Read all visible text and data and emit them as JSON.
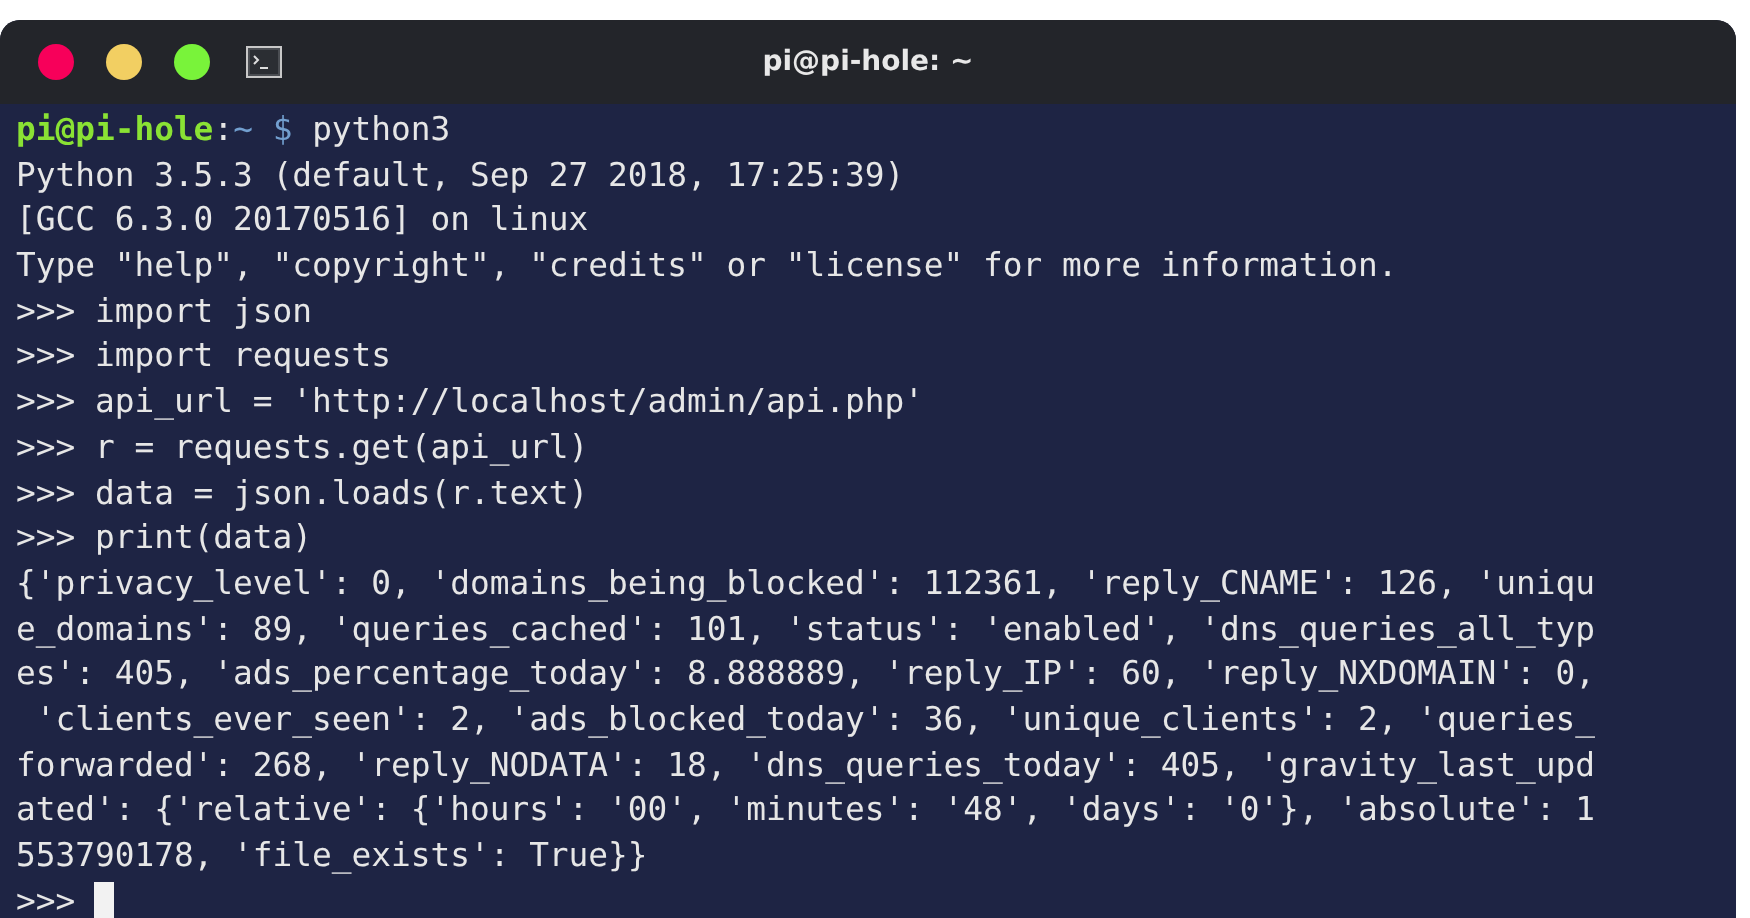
{
  "window": {
    "title": "pi@pi-hole: ~"
  },
  "terminal": {
    "lines": [
      {
        "kind": "prompt",
        "user_host": "pi@pi-hole",
        "separator": ":",
        "path": "~",
        "symbol": "$",
        "command": "python3"
      },
      {
        "kind": "output",
        "text": "Python 3.5.3 (default, Sep 27 2018, 17:25:39)"
      },
      {
        "kind": "output",
        "text": "[GCC 6.3.0 20170516] on linux"
      },
      {
        "kind": "output",
        "text": "Type \"help\", \"copyright\", \"credits\" or \"license\" for more information."
      },
      {
        "kind": "output",
        "text": ">>> import json"
      },
      {
        "kind": "output",
        "text": ">>> import requests"
      },
      {
        "kind": "output",
        "text": ">>> api_url = 'http://localhost/admin/api.php'"
      },
      {
        "kind": "output",
        "text": ">>> r = requests.get(api_url)"
      },
      {
        "kind": "output",
        "text": ">>> data = json.loads(r.text)"
      },
      {
        "kind": "output",
        "text": ">>> print(data)"
      },
      {
        "kind": "output",
        "text": "{'privacy_level': 0, 'domains_being_blocked': 112361, 'reply_CNAME': 126, 'uniqu"
      },
      {
        "kind": "output",
        "text": "e_domains': 89, 'queries_cached': 101, 'status': 'enabled', 'dns_queries_all_typ"
      },
      {
        "kind": "output",
        "text": "es': 405, 'ads_percentage_today': 8.888889, 'reply_IP': 60, 'reply_NXDOMAIN': 0,"
      },
      {
        "kind": "output",
        "text": " 'clients_ever_seen': 2, 'ads_blocked_today': 36, 'unique_clients': 2, 'queries_"
      },
      {
        "kind": "output",
        "text": "forwarded': 268, 'reply_NODATA': 18, 'dns_queries_today': 405, 'gravity_last_upd"
      },
      {
        "kind": "output",
        "text": "ated': {'relative': {'hours': '00', 'minutes': '48', 'days': '0'}, 'absolute': 1"
      },
      {
        "kind": "output",
        "text": "553790178, 'file_exists': True}}"
      },
      {
        "kind": "input",
        "text": ">>>",
        "cursor": true
      }
    ]
  }
}
